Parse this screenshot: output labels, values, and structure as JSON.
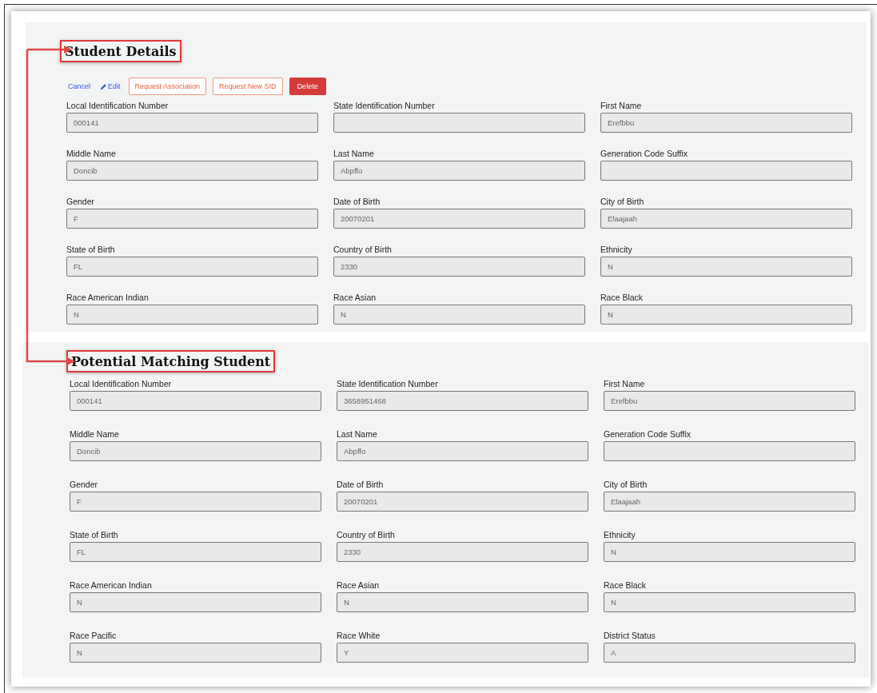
{
  "sections": [
    {
      "title": "Student Details",
      "actions": [
        {
          "kind": "link",
          "label": "Cancel"
        },
        {
          "kind": "edit",
          "label": "Edit"
        },
        {
          "kind": "outline",
          "label": "Request Association"
        },
        {
          "kind": "outline",
          "label": "Request New SID"
        },
        {
          "kind": "danger",
          "label": "Delete"
        }
      ],
      "fields": [
        {
          "label": "Local Identification Number",
          "value": "000141"
        },
        {
          "label": "State Identification Number"
        },
        {
          "label": "First Name",
          "value": "Erefbbu"
        },
        {
          "label": "Middle Name",
          "value": "Doncib"
        },
        {
          "label": "Last Name",
          "value": "Abpffo"
        },
        {
          "label": "Generation Code Suffix"
        },
        {
          "label": "Gender",
          "value": "F"
        },
        {
          "label": "Date of Birth",
          "value": "20070201"
        },
        {
          "label": "City of Birth",
          "value": "Elaajaah"
        },
        {
          "label": "State of Birth",
          "value": "FL"
        },
        {
          "label": "Country of Birth",
          "value": "2330"
        },
        {
          "label": "Ethnicity",
          "value": "N"
        },
        {
          "label": "Race American Indian",
          "value": "N"
        },
        {
          "label": "Race Asian",
          "value": "N"
        },
        {
          "label": "Race Black",
          "value": "N"
        }
      ]
    },
    {
      "title": "Potential Matching Student",
      "fields": [
        {
          "label": "Local Identification Number",
          "value": "000141"
        },
        {
          "label": "State Identification Number",
          "value": "3658951468"
        },
        {
          "label": "First Name",
          "value": "Erefbbu"
        },
        {
          "label": "Middle Name",
          "value": "Doncib"
        },
        {
          "label": "Last Name",
          "value": "Abpffo"
        },
        {
          "label": "Generation Code Suffix"
        },
        {
          "label": "Gender",
          "value": "F"
        },
        {
          "label": "Date of Birth",
          "value": "20070201"
        },
        {
          "label": "City of Birth",
          "value": "Elaajaah"
        },
        {
          "label": "State of Birth",
          "value": "FL"
        },
        {
          "label": "Country of Birth",
          "value": "2330"
        },
        {
          "label": "Ethnicity",
          "value": "N"
        },
        {
          "label": "Race American Indian",
          "value": "N"
        },
        {
          "label": "Race Asian",
          "value": "N"
        },
        {
          "label": "Race Black",
          "value": "N"
        },
        {
          "label": "Race Pacific",
          "value": "N"
        },
        {
          "label": "Race White",
          "value": "Y"
        },
        {
          "label": "District Status",
          "value": "A"
        }
      ]
    }
  ]
}
